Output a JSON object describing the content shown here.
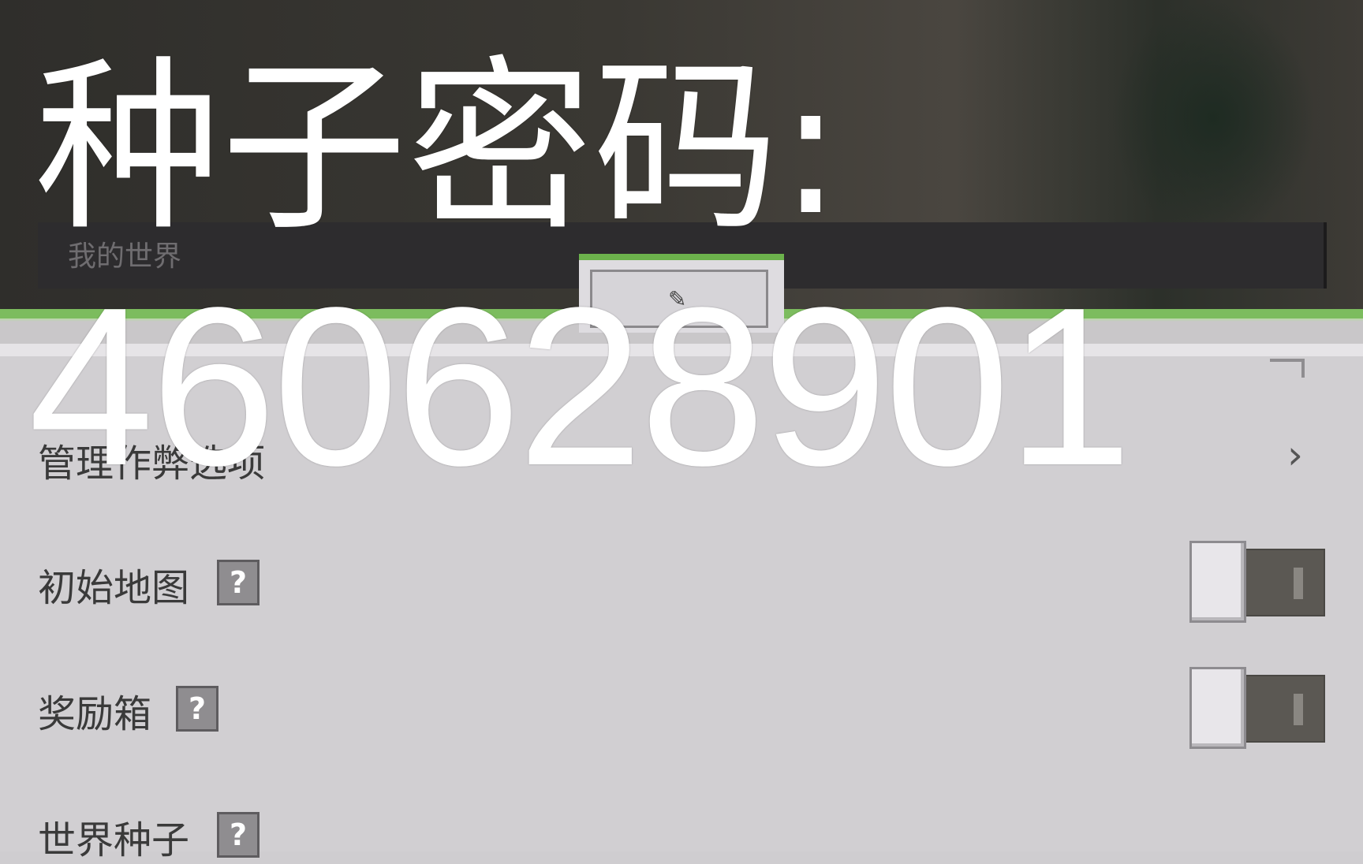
{
  "world_name": {
    "placeholder": "我的世界"
  },
  "tab": {
    "icon": "pencil-icon"
  },
  "settings": {
    "cheats_label": "管理作弊选项",
    "starting_map": {
      "label": "初始地图",
      "help": "?",
      "enabled": false
    },
    "bonus_chest": {
      "label": "奖励箱",
      "help": "?",
      "enabled": false
    },
    "world_seed": {
      "label": "世界种子",
      "help": "?"
    }
  },
  "overlay": {
    "title": "种子密码:",
    "seed": "460628901"
  }
}
